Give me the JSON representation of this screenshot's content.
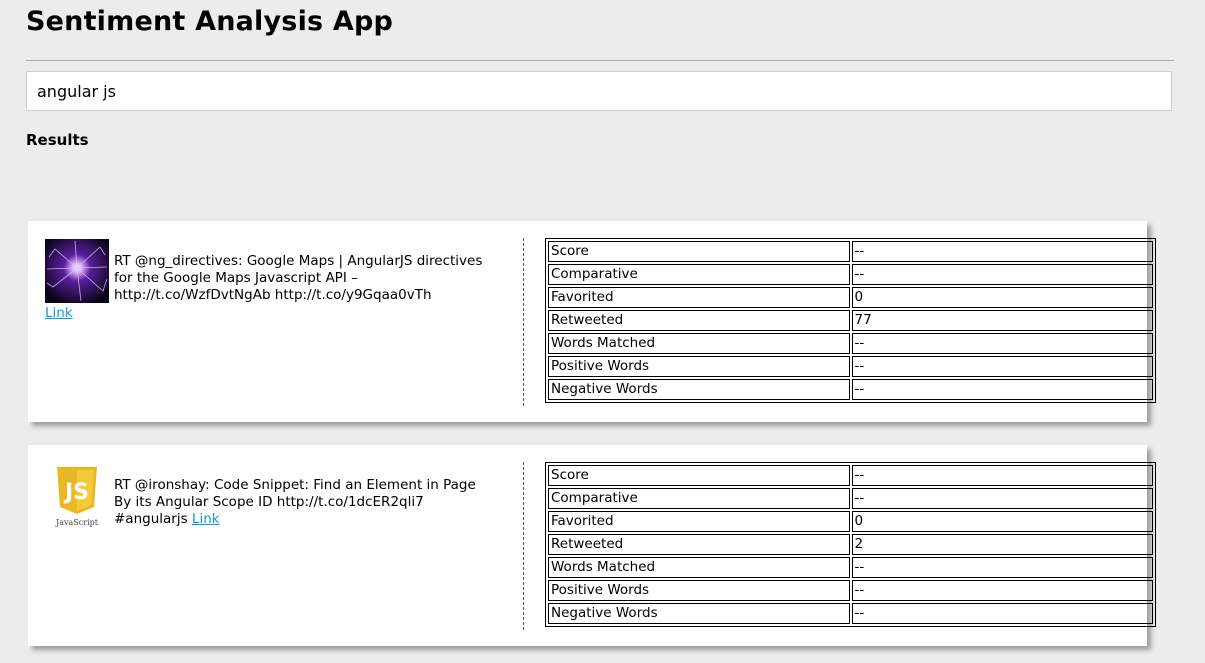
{
  "app": {
    "title": "Sentiment Analysis App",
    "search_value": "angular js",
    "results_heading": "Results"
  },
  "results": [
    {
      "avatar_icon": "purple-plasma-avatar-icon",
      "text": "RT @ng_directives: Google Maps | AngularJS directives for the Google Maps Javascript API – http://t.co/WzfDvtNgAb http://t.co/y9Gqaa0vTh",
      "link_label": "Link",
      "stats": [
        {
          "label": "Score",
          "value": "--"
        },
        {
          "label": "Comparative",
          "value": "--"
        },
        {
          "label": "Favorited",
          "value": "0"
        },
        {
          "label": "Retweeted",
          "value": "77"
        },
        {
          "label": "Words Matched",
          "value": "--"
        },
        {
          "label": "Positive Words",
          "value": "--"
        },
        {
          "label": "Negative Words",
          "value": "--"
        }
      ]
    },
    {
      "avatar_icon": "javascript-shield-icon",
      "avatar_caption": "JavaScript",
      "avatar_logo": "JS",
      "text": "RT @ironshay: Code Snippet: Find an Element in Page By its Angular Scope ID http://t.co/1dcER2qli7 #angularjs",
      "link_label": "Link",
      "stats": [
        {
          "label": "Score",
          "value": "--"
        },
        {
          "label": "Comparative",
          "value": "--"
        },
        {
          "label": "Favorited",
          "value": "0"
        },
        {
          "label": "Retweeted",
          "value": "2"
        },
        {
          "label": "Words Matched",
          "value": "--"
        },
        {
          "label": "Positive Words",
          "value": "--"
        },
        {
          "label": "Negative Words",
          "value": "--"
        }
      ]
    }
  ]
}
